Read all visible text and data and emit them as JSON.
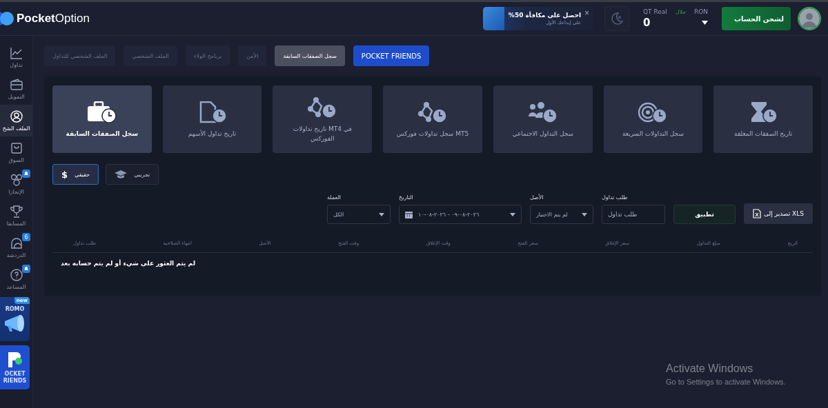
{
  "header": {
    "logo": "PocketOption",
    "promo": {
      "title": "احصل على مكافأة 50%",
      "subtitle": "على إيداعك الأول",
      "close": "×"
    },
    "account": {
      "name": "QT Real",
      "tag": "حلال",
      "currency": "RON",
      "balance": "0"
    },
    "deposit_button": "لشحن الحساب"
  },
  "sidebar": {
    "items": [
      {
        "label": "تداول",
        "selected": false,
        "notification": false
      },
      {
        "label": "التمويل",
        "selected": false,
        "notification": false
      },
      {
        "label": "الملف الشخ",
        "selected": true,
        "notification": false
      },
      {
        "label": "السوق",
        "selected": false,
        "notification": false
      },
      {
        "label": "الإنجازا",
        "selected": false,
        "notification": true
      },
      {
        "label": "المسابقا",
        "selected": false,
        "notification": false
      },
      {
        "label": "الدردشة",
        "selected": false,
        "notification": false,
        "badge": "6"
      },
      {
        "label": "المساعد",
        "selected": false,
        "notification": true
      }
    ],
    "promos": [
      {
        "kind": "promo",
        "text": "ROMO",
        "badge": "new"
      },
      {
        "kind": "friends",
        "text": "OCKET RIENDS"
      }
    ]
  },
  "tabs": [
    {
      "label": "POCKET FRIENDS",
      "kind": "accent",
      "selected": false
    },
    {
      "label": "سجل الصفقات السابقة",
      "kind": "plain",
      "selected": true
    },
    {
      "label": "الأمن",
      "kind": "plain",
      "selected": false
    },
    {
      "label": "برنامج الولاء",
      "kind": "plain",
      "selected": false
    },
    {
      "label": "الملف الشخصي",
      "kind": "plain",
      "selected": false
    },
    {
      "label": "الملف الشخصي للتداول",
      "kind": "plain",
      "selected": false
    }
  ],
  "cards": [
    {
      "label": "تاريخ الصفقات المعلقة",
      "selected": false
    },
    {
      "label": "سجل التداولات السريعة",
      "selected": false
    },
    {
      "label": "سجل التداول الاجتماعي",
      "selected": false
    },
    {
      "label": "MT5 سجل تداولات فوركس",
      "selected": false
    },
    {
      "label": "في MT4 تاريخ تداولات الفوركس",
      "selected": false
    },
    {
      "label": "تاريخ تداول الأسهم",
      "selected": false
    },
    {
      "label": "سجل الصفقات السابقة",
      "selected": true
    }
  ],
  "account_types": [
    {
      "label": "تجريبي",
      "kind": "demo",
      "selected": false
    },
    {
      "label": "حقيقي",
      "kind": "real",
      "symbol": "$",
      "selected": true
    }
  ],
  "filters": {
    "currency": {
      "label": "العملة",
      "value": "الكل"
    },
    "date": {
      "label": "التاريخ",
      "value": "٢٠٢٦-٠٨-٠٩ - ٢٠٢٦-٠٨-١٠"
    },
    "asset": {
      "label": "الأصل",
      "value": "لم يتم الاختيار"
    },
    "order": {
      "label": "طلب تداول",
      "placeholder": "طلب تداول"
    },
    "apply_button": "تطبيق",
    "export_button": "تصدير إلى XLS"
  },
  "table": {
    "columns": [
      "الربح",
      "مبلغ التداول",
      "سعر الإغلاق",
      "سعر الفتح",
      "وقت الإغلاق",
      "وقت الفتح",
      "الأصل",
      "انتهاء الصلاحية",
      "طلب تداول"
    ],
    "empty_message": "لم يتم العثور على شيء أو لم يتم حسابه بعد"
  },
  "watermark": {
    "title": "Activate Windows",
    "subtitle": "Go to Settings to activate Windows."
  }
}
